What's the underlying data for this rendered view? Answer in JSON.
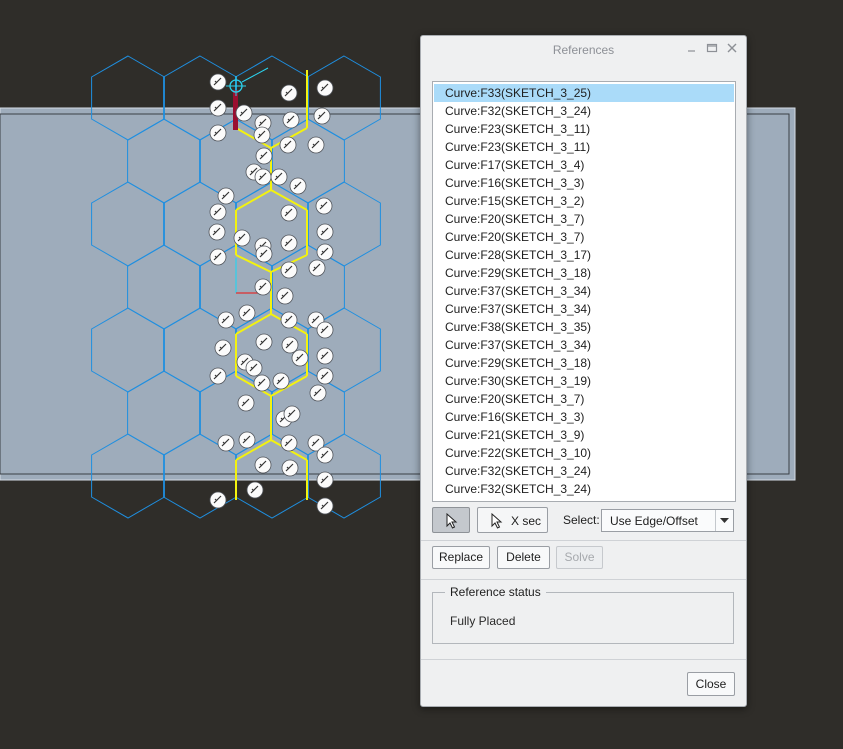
{
  "dialog": {
    "title": "References",
    "references": [
      "Curve:F33(SKETCH_3_25)",
      "Curve:F32(SKETCH_3_24)",
      "Curve:F23(SKETCH_3_11)",
      "Curve:F23(SKETCH_3_11)",
      "Curve:F17(SKETCH_3_4)",
      "Curve:F16(SKETCH_3_3)",
      "Curve:F15(SKETCH_3_2)",
      "Curve:F20(SKETCH_3_7)",
      "Curve:F20(SKETCH_3_7)",
      "Curve:F28(SKETCH_3_17)",
      "Curve:F29(SKETCH_3_18)",
      "Curve:F37(SKETCH_3_34)",
      "Curve:F37(SKETCH_3_34)",
      "Curve:F38(SKETCH_3_35)",
      "Curve:F37(SKETCH_3_34)",
      "Curve:F29(SKETCH_3_18)",
      "Curve:F30(SKETCH_3_19)",
      "Curve:F20(SKETCH_3_7)",
      "Curve:F16(SKETCH_3_3)",
      "Curve:F21(SKETCH_3_9)",
      "Curve:F22(SKETCH_3_10)",
      "Curve:F32(SKETCH_3_24)",
      "Curve:F32(SKETCH_3_24)"
    ],
    "selected_index": 0,
    "toolbar": {
      "xsec_label": "X sec",
      "select_label": "Select:",
      "select_value": "Use Edge/Offset"
    },
    "actions": {
      "replace": "Replace",
      "delete": "Delete",
      "solve": "Solve"
    },
    "status": {
      "heading": "Reference status",
      "value": "Fully Placed"
    },
    "close_label": "Close"
  },
  "colors": {
    "background": "#2f2d29",
    "part_face": "#9eacbb",
    "hex_edges": "#1f8fe0",
    "selected_edges": "#f3f20f",
    "highlight_edge": "#9a0f30",
    "list_selection": "#aadbf9"
  }
}
